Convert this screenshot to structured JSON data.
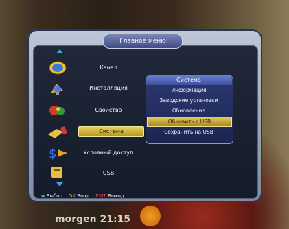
{
  "menu": {
    "title": "Главное меню",
    "items": [
      {
        "label": "Канал",
        "icon": "tv-icon"
      },
      {
        "label": "Инсталляция",
        "icon": "satellite-dish-icon"
      },
      {
        "label": "Свойство",
        "icon": "gear-icon"
      },
      {
        "label": "Система",
        "icon": "system-icon",
        "selected": true
      },
      {
        "label": "Условный доступ",
        "icon": "dollar-icon"
      },
      {
        "label": "USB",
        "icon": "usb-icon"
      }
    ]
  },
  "submenu": {
    "title": "Система",
    "items": [
      {
        "label": "Информация"
      },
      {
        "label": "Заводские установки"
      },
      {
        "label": "Обновление"
      },
      {
        "label": "Обновить с USB",
        "selected": true
      },
      {
        "label": "Сохранить на USB"
      }
    ]
  },
  "footer": {
    "select_key": "◆",
    "select_label": "Выбор",
    "ok_key": "OK",
    "ok_label": "Ввод",
    "exit_key": "EXIT",
    "exit_label": "Выход"
  },
  "background": {
    "text": "morgen 21:15"
  },
  "colors": {
    "accent_blue": "#3da4e8",
    "highlight_gold": "#e7d060",
    "panel_dark": "#141b2a",
    "submenu_blue": "#2c3a72"
  }
}
